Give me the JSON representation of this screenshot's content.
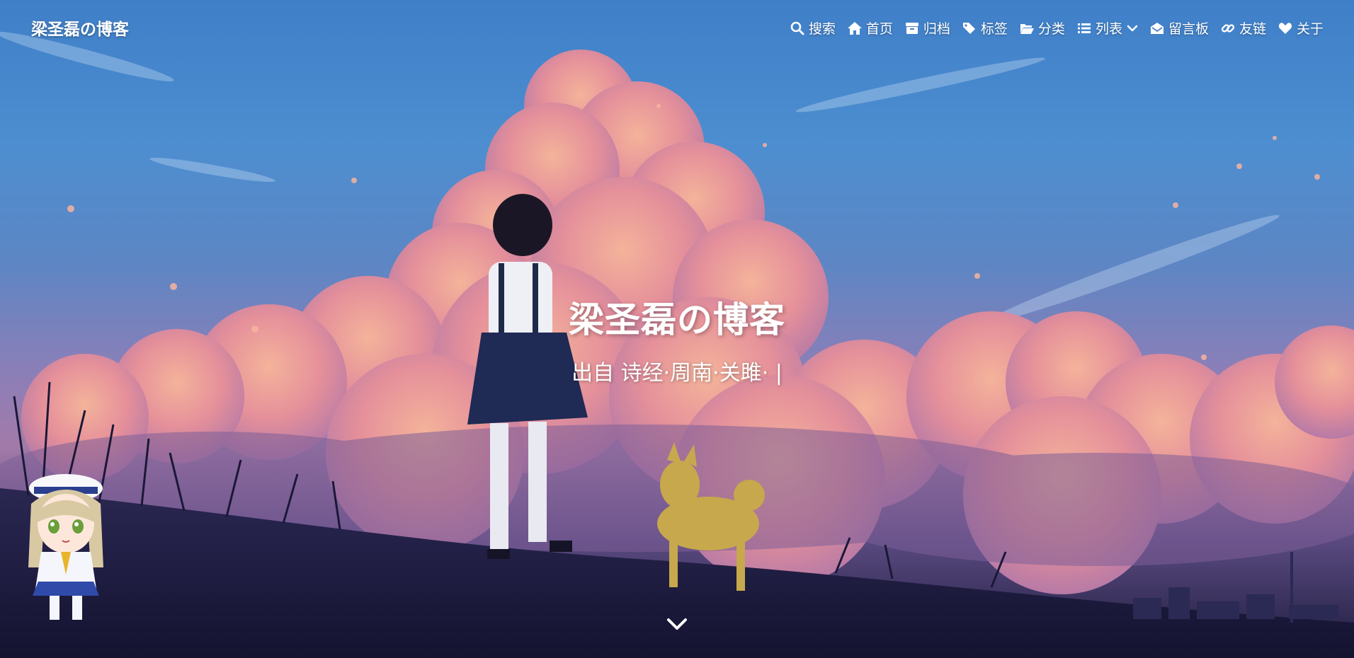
{
  "site": {
    "name": "梁圣磊の博客",
    "title": "梁圣磊の博客",
    "subtitle": "出自 诗经·周南·关雎·",
    "cursor": "|"
  },
  "nav": {
    "items": [
      {
        "label": "搜索",
        "icon": "search-icon"
      },
      {
        "label": "首页",
        "icon": "home-icon"
      },
      {
        "label": "归档",
        "icon": "archive-icon"
      },
      {
        "label": "标签",
        "icon": "tags-icon"
      },
      {
        "label": "分类",
        "icon": "folder-open-icon"
      },
      {
        "label": "列表",
        "icon": "list-icon"
      },
      {
        "label": "留言板",
        "icon": "envelope-open-icon"
      },
      {
        "label": "友链",
        "icon": "link-icon"
      },
      {
        "label": "关于",
        "icon": "heart-icon"
      }
    ]
  },
  "colors": {
    "sky_top": "#3f7fc8",
    "cloud_pink": "#f0a08f",
    "ground": "#1e1c3e",
    "text": "#ffffff"
  }
}
